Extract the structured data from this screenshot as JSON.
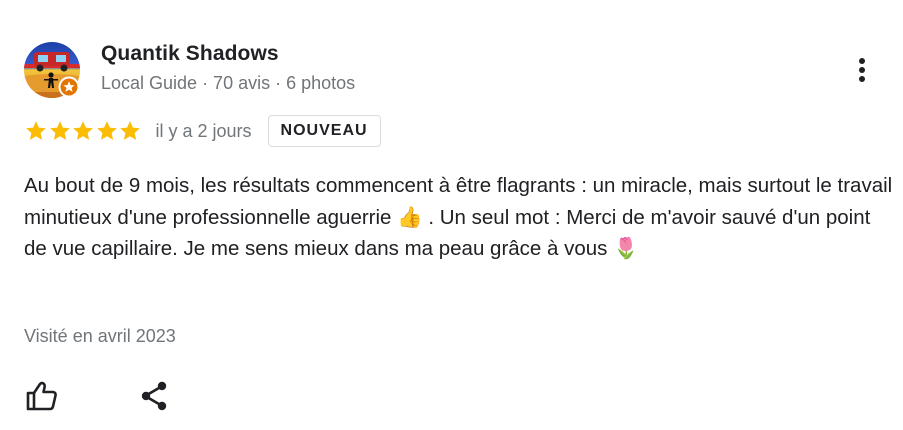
{
  "reviewer": {
    "name": "Quantik Shadows",
    "meta": "Local Guide · 70 avis · 6 photos",
    "avatar_icon": "landscape-silhouette-avatar",
    "badge_icon": "local-guide-star-badge",
    "badge_color": "#e37400"
  },
  "rating": {
    "stars": 5,
    "max_stars": 5,
    "star_color": "#fbbc04",
    "relative_date": "il y a 2 jours",
    "badge_label": "NOUVEAU"
  },
  "review": {
    "text": "Au bout de 9 mois, les résultats commencent à être flagrants : un miracle, mais surtout le travail minutieux d'une professionnelle aguerrie 👍 . Un seul mot : Merci de m'avoir sauvé d'un point de vue capillaire. Je me sens mieux dans ma peau grâce à vous 🌷",
    "visit": "Visité en avril 2023"
  },
  "actions": {
    "more_icon": "more-vert-icon",
    "like_icon": "thumb-up-icon",
    "share_icon": "share-icon"
  },
  "colors": {
    "primary_text": "#202124",
    "secondary_text": "#70757a",
    "border": "#dadce0"
  }
}
